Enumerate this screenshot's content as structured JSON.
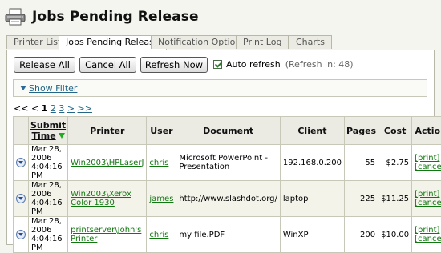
{
  "header": {
    "title": "Jobs Pending Release"
  },
  "tabs": [
    {
      "label": "Printer List"
    },
    {
      "label": "Jobs Pending Release"
    },
    {
      "label": "Notification Options"
    },
    {
      "label": "Print Log"
    },
    {
      "label": "Charts"
    }
  ],
  "toolbar": {
    "release_all": "Release All",
    "cancel_all": "Cancel All",
    "refresh_now": "Refresh Now",
    "auto_refresh": "Auto refresh",
    "refresh_note": "(Refresh in: 48)"
  },
  "filter": {
    "label": "Show Filter"
  },
  "pager": {
    "first": "<<",
    "prev": "<",
    "p1": "1",
    "p2": "2",
    "p3": "3",
    "next": ">",
    "last": ">>"
  },
  "columns": {
    "submit": "Submit Time",
    "printer": "Printer",
    "user": "User",
    "document": "Document",
    "client": "Client",
    "pages": "Pages",
    "cost": "Cost",
    "action": "Action"
  },
  "rows": [
    {
      "time": "Mar 28, 2006 4:04:16 PM",
      "printer": "Win2003\\HPLaserJ",
      "user": "chris",
      "document": "Microsoft PowerPoint - Presentation",
      "client": "192.168.0.200",
      "pages": "55",
      "cost": "$2.75",
      "print": "[print]",
      "cancel": "[cancel]"
    },
    {
      "time": "Mar 28, 2006 4:04:16 PM",
      "printer": "Win2003\\Xerox Color 1930",
      "user": "james",
      "document": "http://www.slashdot.org/",
      "client": "laptop",
      "pages": "225",
      "cost": "$11.25",
      "print": "[print]",
      "cancel": "[cancel]"
    },
    {
      "time": "Mar 28, 2006 4:04:16 PM",
      "printer": "printserver\\John's Printer",
      "user": "chris",
      "document": "my file.PDF",
      "client": "WinXP",
      "pages": "200",
      "cost": "$10.00",
      "print": "[print]",
      "cancel": "[cancel]"
    }
  ]
}
